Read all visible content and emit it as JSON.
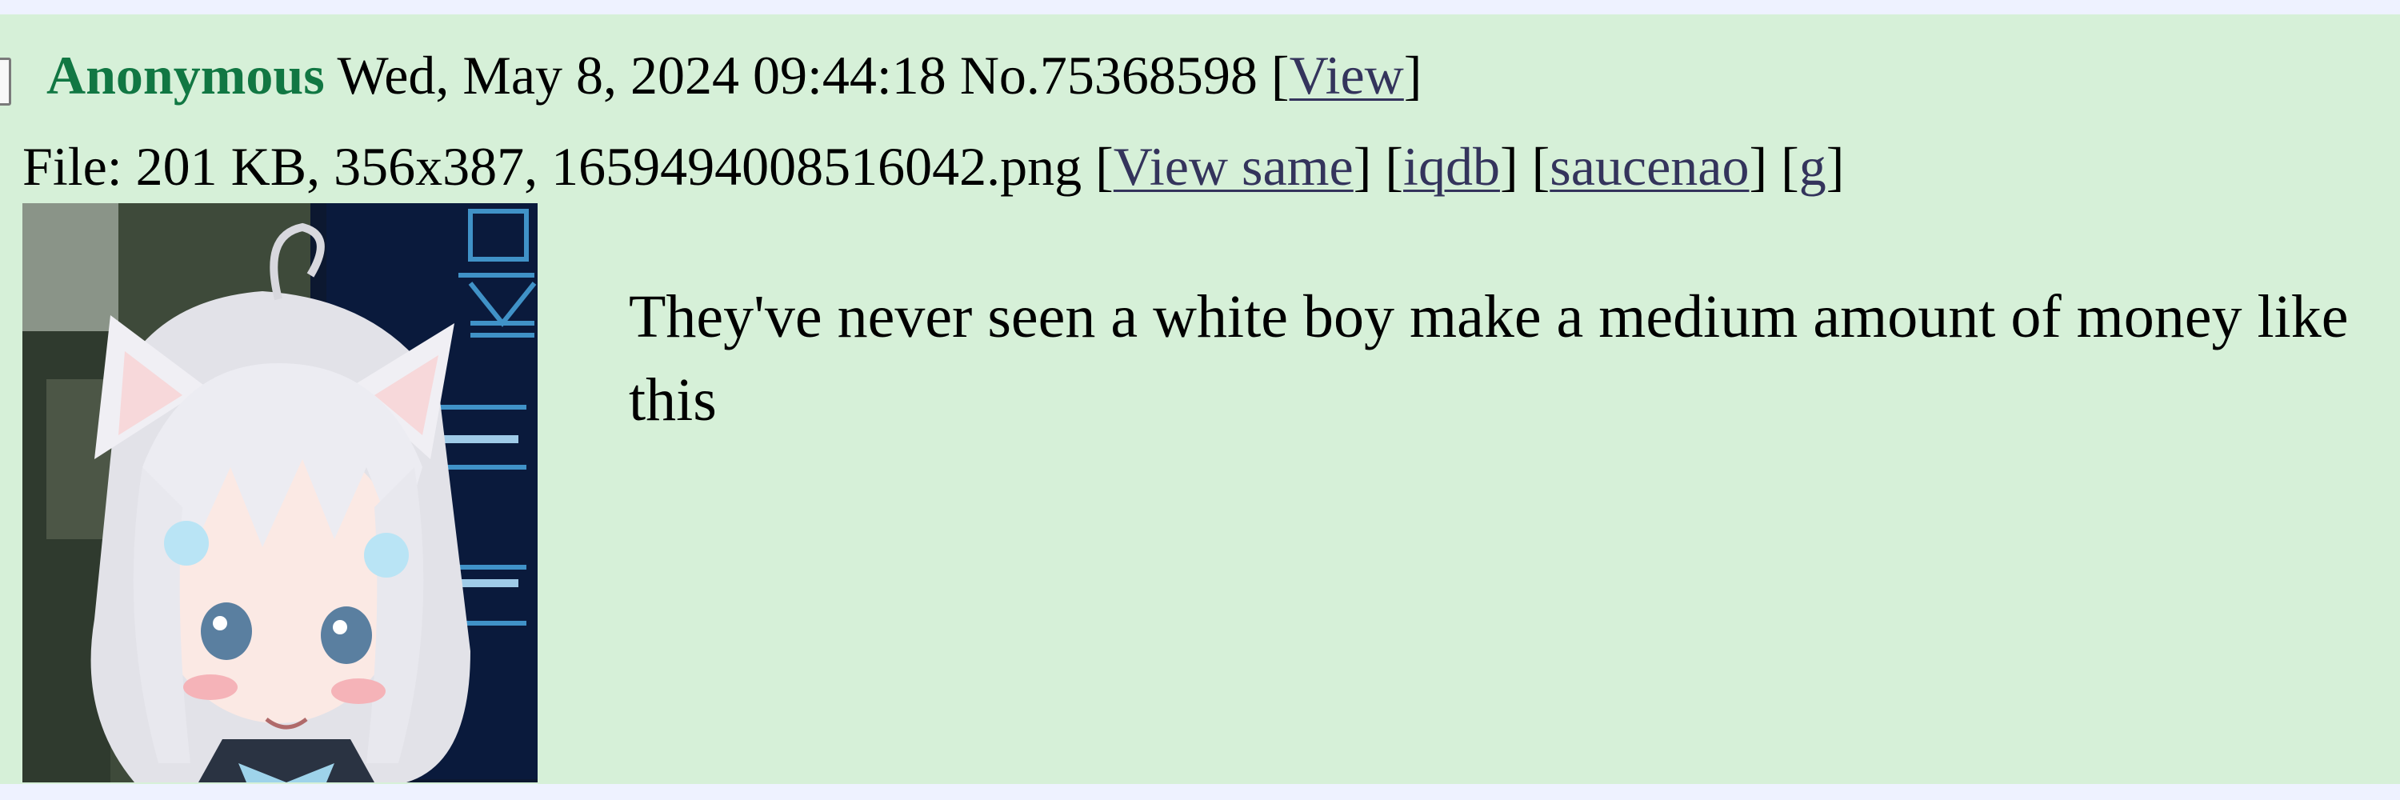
{
  "post": {
    "name": "Anonymous",
    "datetime": "Wed, May 8, 2024 09:44:18",
    "number": "No.75368598",
    "view_link": "View",
    "file": {
      "info": "File: 201 KB, 356x387, 1659494008516042.png",
      "links": [
        "View same",
        "iqdb",
        "saucenao",
        "g"
      ]
    },
    "comment": "They've never seen a white boy make a medium amount of money like this"
  },
  "colors": {
    "post_bg": "#d6f0d8",
    "name": "#117743",
    "link": "#34345c"
  },
  "icons": {
    "thumbnail": "anime-catgirl-thumbnail"
  }
}
